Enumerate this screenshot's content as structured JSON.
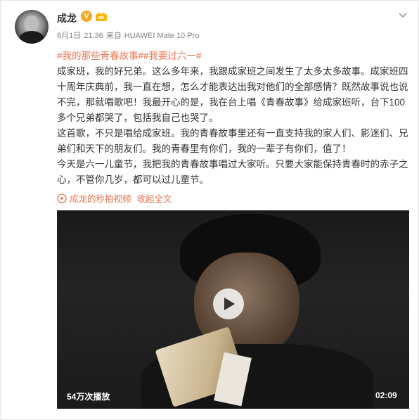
{
  "user": {
    "name": "成龙",
    "verified_badge": "V",
    "badge_color": "#f5a623"
  },
  "meta": {
    "date": "6月1日",
    "time": "21:36",
    "via_prefix": "来自",
    "device": "HUAWEI Mate 10 Pro"
  },
  "hashtags": [
    "#我的那些青春故事#",
    "#我要过六一#"
  ],
  "paragraphs": [
    "成家班，我的好兄弟。这么多年来，我跟成家班之间发生了太多太多故事。成家班四十周年庆典前，我一直在想，怎么才能表达出我对他们的全部感情？既然故事说也说不完，那就唱歌吧！我最开心的是，我在台上唱《青春故事》给成家班听，台下100多个兄弟都哭了，包括我自己也哭了。",
    "这首歌，不只是唱给成家班。我的青春故事里还有一直支持我的家人们、影迷们、兄弟们和天下的朋友们。我的青春里有你们，我的一辈子有你们，值了！",
    "今天是六一儿童节，我把我的青春故事唱过大家听。只要大家能保持青春时的赤子之心，不管你几岁，都可以过儿童节。"
  ],
  "links": {
    "video_link": "成龙的秒拍视频",
    "collapse": "收起全文"
  },
  "video": {
    "views": "54万次播放",
    "duration": "02:09"
  },
  "colors": {
    "link": "#eb7350",
    "meta": "#808080",
    "text": "#333333"
  }
}
